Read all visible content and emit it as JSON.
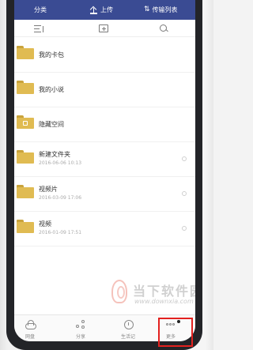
{
  "topbar": {
    "category_label": "分类",
    "upload_label": "上传",
    "transfer_label": "传输列表"
  },
  "toolbar": {
    "icons": [
      "sort-icon",
      "new-folder-icon",
      "search-icon"
    ]
  },
  "files": [
    {
      "name": "我的卡包",
      "date": "",
      "icon": "folder-icon"
    },
    {
      "name": "我的小说",
      "date": "",
      "icon": "folder-icon"
    },
    {
      "name": "隐藏空间",
      "date": "",
      "icon": "lock-folder-icon"
    },
    {
      "name": "新建文件夹",
      "date": "2016-06-06 10:13",
      "icon": "folder-icon"
    },
    {
      "name": "视频片",
      "date": "2016-03-09 17:06",
      "icon": "folder-icon"
    },
    {
      "name": "视频",
      "date": "2016-01-09 17:51",
      "icon": "folder-icon"
    }
  ],
  "bottom_nav": {
    "cloud_label": "网盘",
    "share_label": "分享",
    "life_label": "生活记",
    "more_label": "更多"
  },
  "watermark": {
    "text": "当下软件园",
    "url": "www.downxia.com"
  },
  "colors": {
    "topbar": "#3a4b93",
    "folder": "#e0bb52",
    "highlight": "#e3211f"
  }
}
